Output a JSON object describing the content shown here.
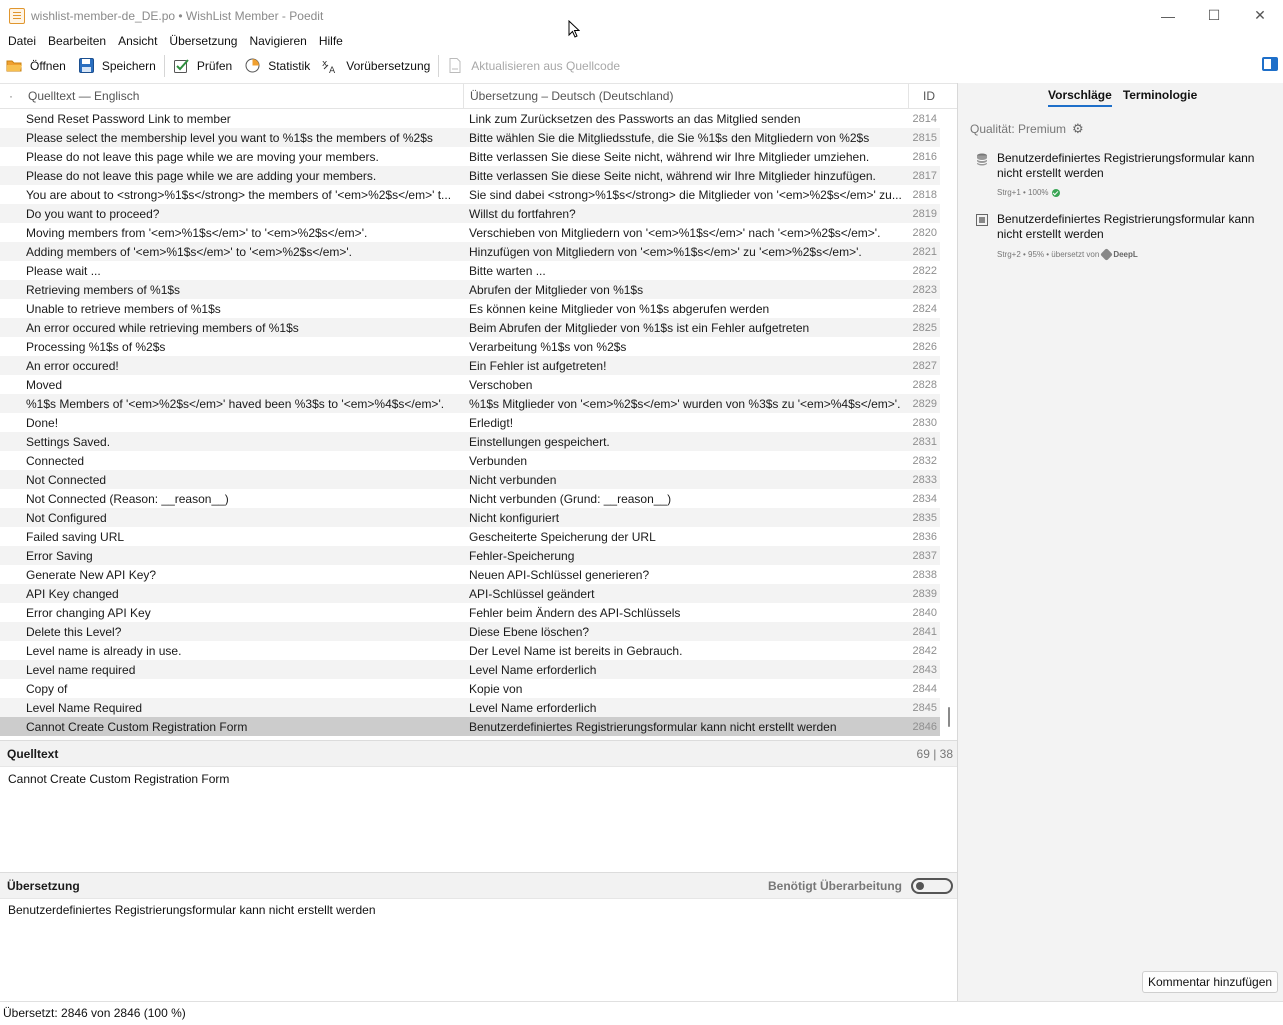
{
  "window": {
    "title": "wishlist-member-de_DE.po • WishList Member - Poedit",
    "controls": {
      "minimize": "—",
      "maximize": "☐",
      "close": "✕"
    }
  },
  "menu": [
    "Datei",
    "Bearbeiten",
    "Ansicht",
    "Übersetzung",
    "Navigieren",
    "Hilfe"
  ],
  "toolbar": {
    "open": "Öffnen",
    "save": "Speichern",
    "validate": "Prüfen",
    "stats": "Statistik",
    "pretranslate": "Vorübersetzung",
    "update": "Aktualisieren aus Quellcode"
  },
  "list": {
    "header": {
      "dot": "·",
      "source": "Quelltext — Englisch",
      "translation": "Übersetzung – Deutsch (Deutschland)",
      "id": "ID"
    },
    "rows": [
      {
        "src": "Send Reset Password Link to member",
        "trn": "Link zum Zurücksetzen des Passworts an das Mitglied senden",
        "id": "2814"
      },
      {
        "src": "Please select the membership level you want to %1$s the members of %2$s",
        "trn": "Bitte wählen Sie die Mitgliedsstufe, die Sie %1$s den Mitgliedern von %2$s",
        "id": "2815"
      },
      {
        "src": "Please do not leave this page while we are moving your members.",
        "trn": "Bitte verlassen Sie diese Seite nicht, während wir Ihre Mitglieder umziehen.",
        "id": "2816"
      },
      {
        "src": "Please do not leave this page while we are adding your members.",
        "trn": "Bitte verlassen Sie diese Seite nicht, während wir Ihre Mitglieder hinzufügen.",
        "id": "2817"
      },
      {
        "src": "You are about to <strong>%1$s</strong> the members of '<em>%2$s</em>' t...",
        "trn": "Sie sind dabei <strong>%1$s</strong> die Mitglieder von '<em>%2$s</em>' zu...",
        "id": "2818"
      },
      {
        "src": "Do you want to proceed?",
        "trn": "Willst du fortfahren?",
        "id": "2819"
      },
      {
        "src": "Moving members from '<em>%1$s</em>' to '<em>%2$s</em>'.",
        "trn": "Verschieben von Mitgliedern von '<em>%1$s</em>' nach '<em>%2$s</em>'.",
        "id": "2820"
      },
      {
        "src": "Adding members of '<em>%1$s</em>' to '<em>%2$s</em>'.",
        "trn": "Hinzufügen von Mitgliedern von '<em>%1$s</em>' zu '<em>%2$s</em>'.",
        "id": "2821"
      },
      {
        "src": "Please wait ...",
        "trn": "Bitte warten ...",
        "id": "2822"
      },
      {
        "src": "Retrieving members of %1$s",
        "trn": "Abrufen der Mitglieder von %1$s",
        "id": "2823"
      },
      {
        "src": "Unable to retrieve members of %1$s",
        "trn": "Es können keine Mitglieder von %1$s abgerufen werden",
        "id": "2824"
      },
      {
        "src": "An error occured while retrieving members of %1$s",
        "trn": "Beim Abrufen der Mitglieder von %1$s ist ein Fehler aufgetreten",
        "id": "2825"
      },
      {
        "src": "Processing %1$s of %2$s",
        "trn": "Verarbeitung %1$s von %2$s",
        "id": "2826"
      },
      {
        "src": "An error occured!",
        "trn": "Ein Fehler ist aufgetreten!",
        "id": "2827"
      },
      {
        "src": "Moved",
        "trn": "Verschoben",
        "id": "2828"
      },
      {
        "src": "%1$s Members of '<em>%2$s</em>' haved been %3$s to '<em>%4$s</em>'.",
        "trn": "%1$s Mitglieder von '<em>%2$s</em>' wurden von %3$s zu '<em>%4$s</em>'.",
        "id": "2829"
      },
      {
        "src": "Done!",
        "trn": "Erledigt!",
        "id": "2830"
      },
      {
        "src": "Settings Saved.",
        "trn": "Einstellungen gespeichert.",
        "id": "2831"
      },
      {
        "src": "Connected",
        "trn": "Verbunden",
        "id": "2832"
      },
      {
        "src": "Not Connected",
        "trn": "Nicht verbunden",
        "id": "2833"
      },
      {
        "src": "Not Connected (Reason: __reason__)",
        "trn": "Nicht verbunden (Grund: __reason__)",
        "id": "2834"
      },
      {
        "src": "Not Configured",
        "trn": "Nicht konfiguriert",
        "id": "2835"
      },
      {
        "src": "Failed saving URL",
        "trn": "Gescheiterte Speicherung der URL",
        "id": "2836"
      },
      {
        "src": "Error Saving",
        "trn": "Fehler-Speicherung",
        "id": "2837"
      },
      {
        "src": "Generate New API Key?",
        "trn": "Neuen API-Schlüssel generieren?",
        "id": "2838"
      },
      {
        "src": "API Key changed",
        "trn": "API-Schlüssel geändert",
        "id": "2839"
      },
      {
        "src": "Error changing API Key",
        "trn": "Fehler beim Ändern des API-Schlüssels",
        "id": "2840"
      },
      {
        "src": "Delete this Level?",
        "trn": "Diese Ebene löschen?",
        "id": "2841"
      },
      {
        "src": "Level name is already in use.",
        "trn": "Der Level Name ist bereits in Gebrauch.",
        "id": "2842"
      },
      {
        "src": "Level name required",
        "trn": "Level Name erforderlich",
        "id": "2843"
      },
      {
        "src": "Copy of",
        "trn": "Kopie von",
        "id": "2844"
      },
      {
        "src": "Level Name Required",
        "trn": "Level Name erforderlich",
        "id": "2845"
      },
      {
        "src": "Cannot Create Custom Registration Form",
        "trn": "Benutzerdefiniertes Registrierungsformular kann nicht erstellt werden",
        "id": "2846",
        "selected": true
      }
    ]
  },
  "source_panel": {
    "title": "Quelltext",
    "count": "69 | 38",
    "text": "Cannot Create Custom Registration Form"
  },
  "translation_panel": {
    "title": "Übersetzung",
    "needs_work_label": "Benötigt Überarbeitung",
    "needs_work": false,
    "text": "Benutzerdefiniertes Registrierungsformular kann nicht erstellt werden"
  },
  "sidebar": {
    "tabs": [
      "Vorschläge",
      "Terminologie"
    ],
    "quality": "Qualität: Premium",
    "suggestions": [
      {
        "text": "Benutzerdefiniertes Registrierungsformular kann nicht erstellt werden",
        "meta": "Strg+1 • 100%",
        "icon": "database-icon"
      },
      {
        "text": "Benutzerdefiniertes Registrierungsformular kann nicht erstellt werden",
        "meta": "Strg+2 • 95% • übersetzt von",
        "provider": "DeepL",
        "icon": "machine-translation-icon"
      }
    ],
    "add_comment": "Kommentar hinzufügen"
  },
  "status": "Übersetzt: 2846 von 2846 (100 %)",
  "colors": {
    "accent": "#1e6fc9",
    "selected_row": "#cccccc",
    "ok_green": "#3aa655"
  }
}
